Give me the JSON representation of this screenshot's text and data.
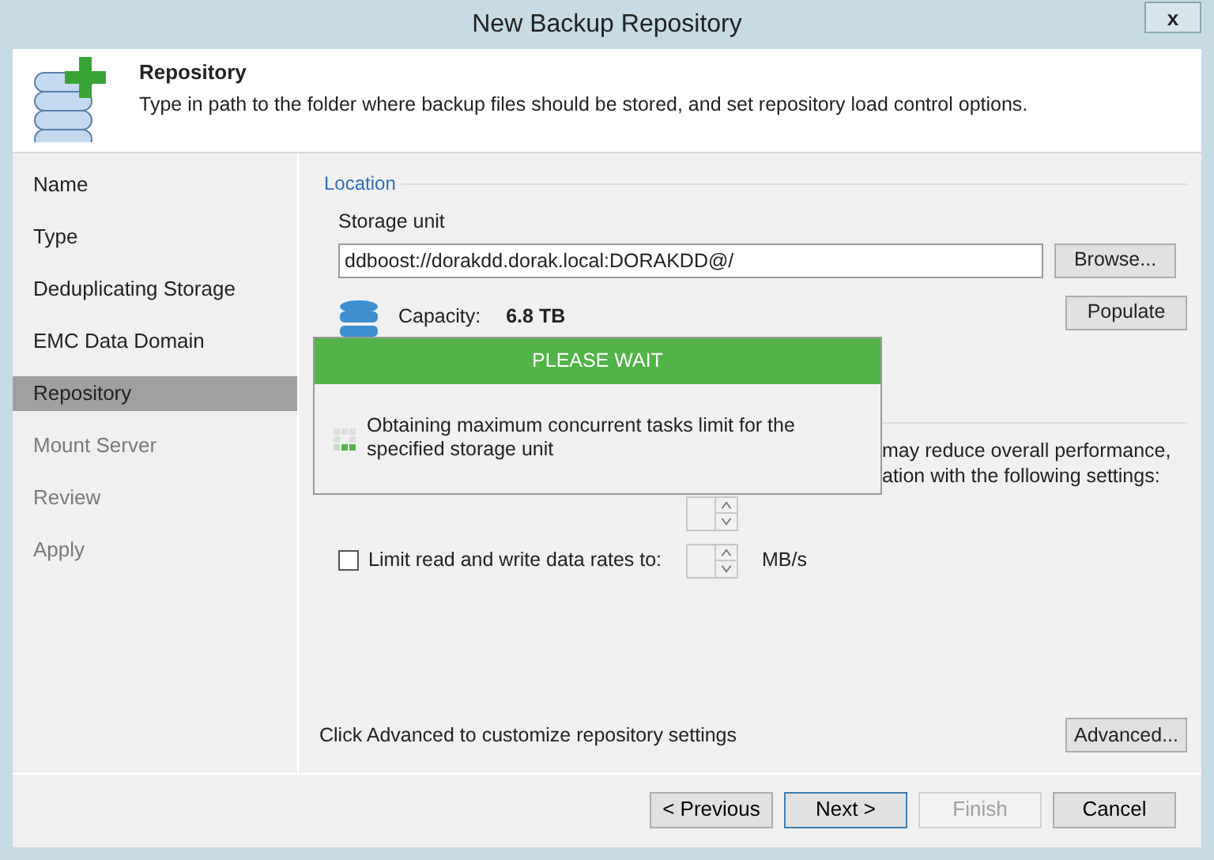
{
  "window": {
    "title": "New Backup Repository",
    "close": "x"
  },
  "header": {
    "title": "Repository",
    "description": "Type in path to the folder where backup files should be stored, and set repository load control options."
  },
  "sidebar": {
    "items": [
      {
        "label": "Name",
        "selected": false,
        "disabled": false
      },
      {
        "label": "Type",
        "selected": false,
        "disabled": false
      },
      {
        "label": "Deduplicating Storage",
        "selected": false,
        "disabled": false
      },
      {
        "label": "EMC Data Domain",
        "selected": false,
        "disabled": false
      },
      {
        "label": "Repository",
        "selected": true,
        "disabled": false
      },
      {
        "label": "Mount Server",
        "selected": false,
        "disabled": true
      },
      {
        "label": "Review",
        "selected": false,
        "disabled": true
      },
      {
        "label": "Apply",
        "selected": false,
        "disabled": true
      }
    ]
  },
  "location": {
    "heading": "Location",
    "storage_label": "Storage unit",
    "storage_value": "ddboost://dorakdd.dorak.local:DORAKDD@/",
    "browse": "Browse...",
    "populate": "Populate",
    "capacity_label": "Capacity:",
    "capacity_value": "6.8 TB"
  },
  "load_control": {
    "text_lines": [
      "may reduce overall performance,",
      "ation with the following settings:"
    ],
    "limit_rate": {
      "label": "Limit read and write data rates to:",
      "checked": false,
      "unit": "MB/s"
    }
  },
  "advanced": {
    "text": "Click Advanced to customize repository settings",
    "button": "Advanced..."
  },
  "buttons": [
    {
      "label": "< Previous",
      "disabled": false,
      "default": false
    },
    {
      "label": "Next >",
      "disabled": false,
      "default": true
    },
    {
      "label": "Finish",
      "disabled": true,
      "default": false
    },
    {
      "label": "Cancel",
      "disabled": false,
      "default": false
    }
  ],
  "wait_dialog": {
    "title": "PLEASE WAIT",
    "message": "Obtaining maximum concurrent tasks limit for the specified storage unit"
  }
}
